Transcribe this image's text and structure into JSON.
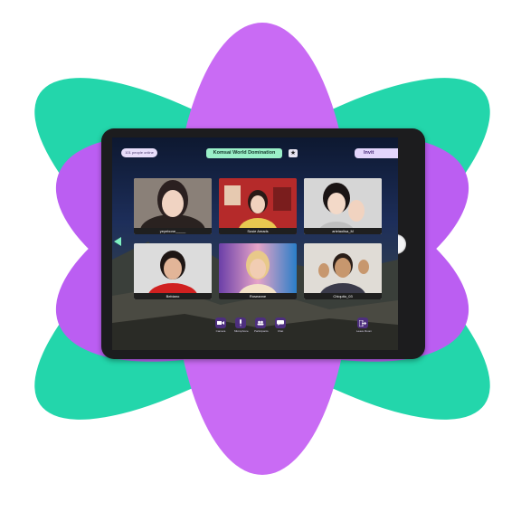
{
  "header": {
    "online_count": "101 people online",
    "room_title": "Komsai World Domination",
    "star_icon": "star-icon",
    "invite_label": "Invit"
  },
  "participants": [
    {
      "name": "yeyebone_____"
    },
    {
      "name": "Susie Amads"
    },
    {
      "name": "arielaolisa_M"
    },
    {
      "name": "Bebiano"
    },
    {
      "name": "Roseanne"
    },
    {
      "name": "Chiquito_03"
    }
  ],
  "toolbar": {
    "camera_label": "Camera",
    "microphone_label": "Microphone",
    "participants_label": "Participants",
    "chat_label": "Chat",
    "leave_label": "Leave Room"
  },
  "colors": {
    "petal_purple": "#b95cf0",
    "petal_green": "#22d7ab",
    "pill_mint": "#9af0c8",
    "toolbar_purple": "#4d2f7e"
  }
}
